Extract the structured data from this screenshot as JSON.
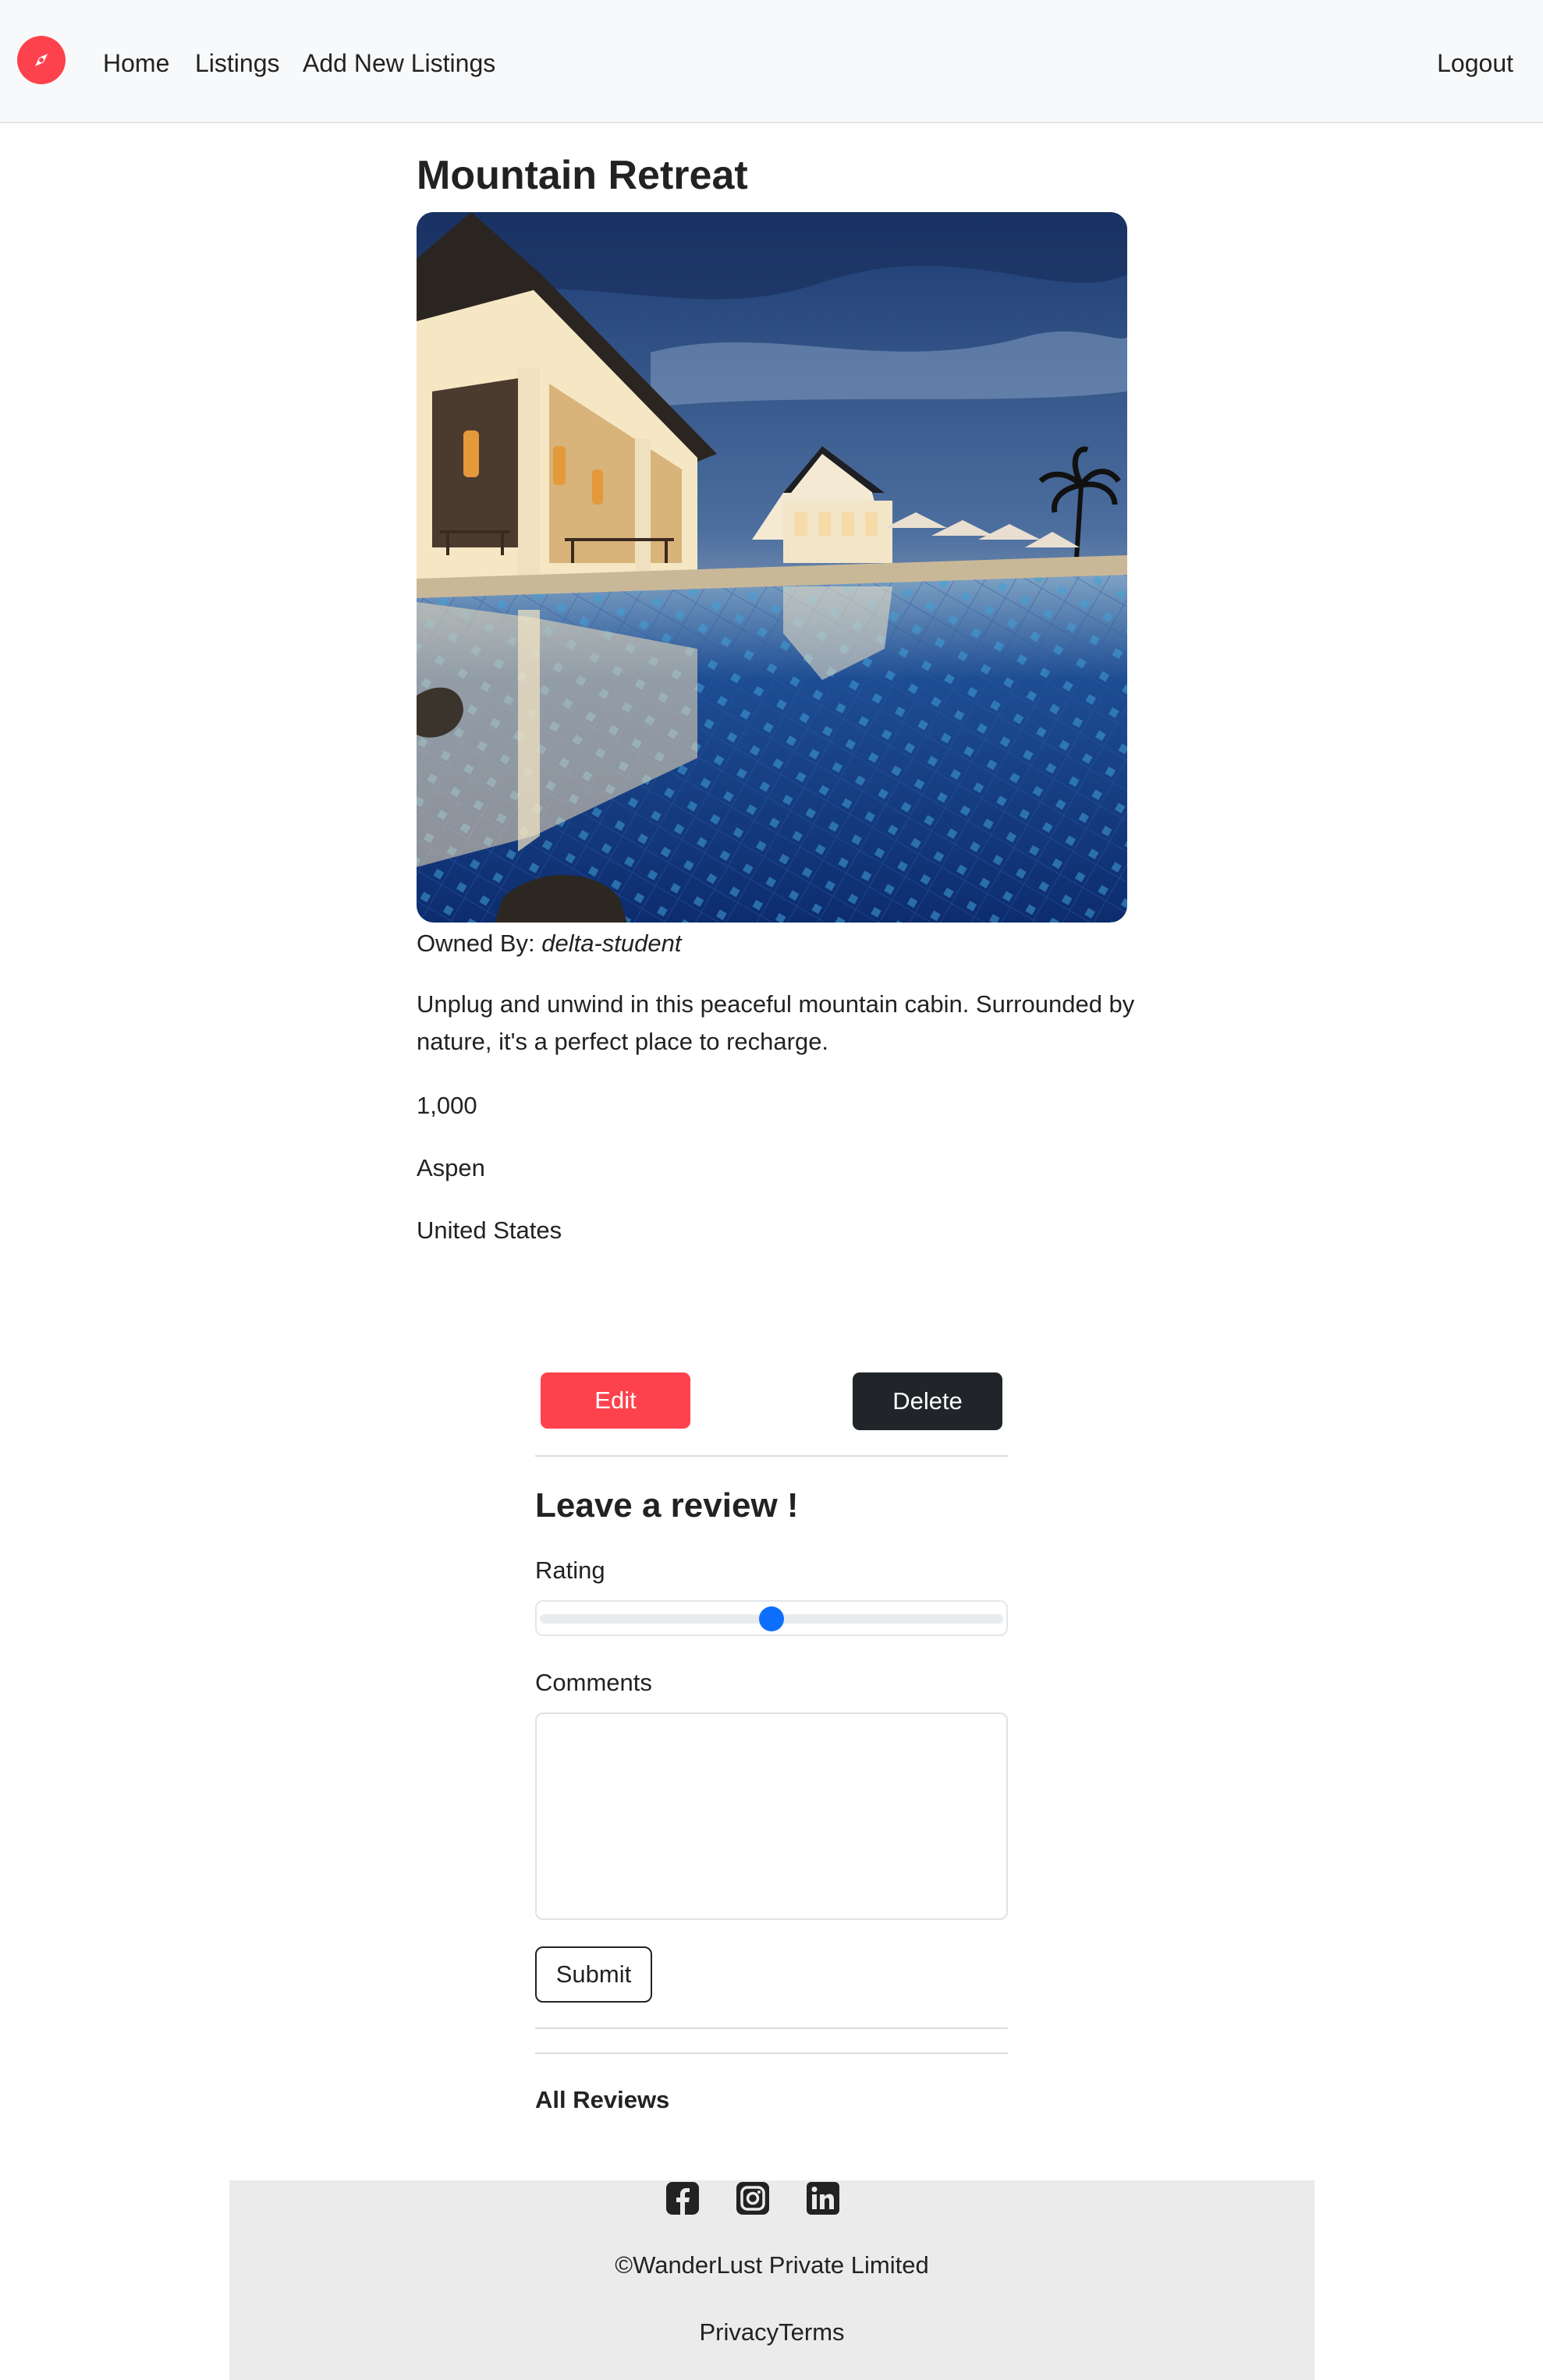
{
  "nav": {
    "brand_icon": "compass-icon",
    "brand_color": "#fe424d",
    "links": [
      "Home",
      "Listings",
      "Add New Listings"
    ],
    "logout": "Logout"
  },
  "listing": {
    "title": "Mountain Retreat",
    "owner_label": "Owned By:",
    "owner": "delta-student",
    "description": "Unplug and unwind in this peaceful mountain cabin. Surrounded by nature, it's a perfect place to recharge.",
    "price": "1,000",
    "location": "Aspen",
    "country": "United States"
  },
  "actions": {
    "edit_label": "Edit",
    "delete_label": "Delete",
    "edit_color": "#fe424d",
    "delete_color": "#212529"
  },
  "review_form": {
    "heading": "Leave a review !",
    "rating_label": "Rating",
    "rating_value": 3,
    "rating_min": 1,
    "rating_max": 5,
    "comments_label": "Comments",
    "comments_value": "",
    "submit_label": "Submit"
  },
  "reviews": {
    "heading": "All Reviews"
  },
  "footer": {
    "social_icons": [
      "facebook-icon",
      "instagram-icon",
      "linkedin-icon"
    ],
    "copyright": "©WanderLust Private Limited",
    "privacy": "Privacy",
    "terms": "Terms"
  }
}
